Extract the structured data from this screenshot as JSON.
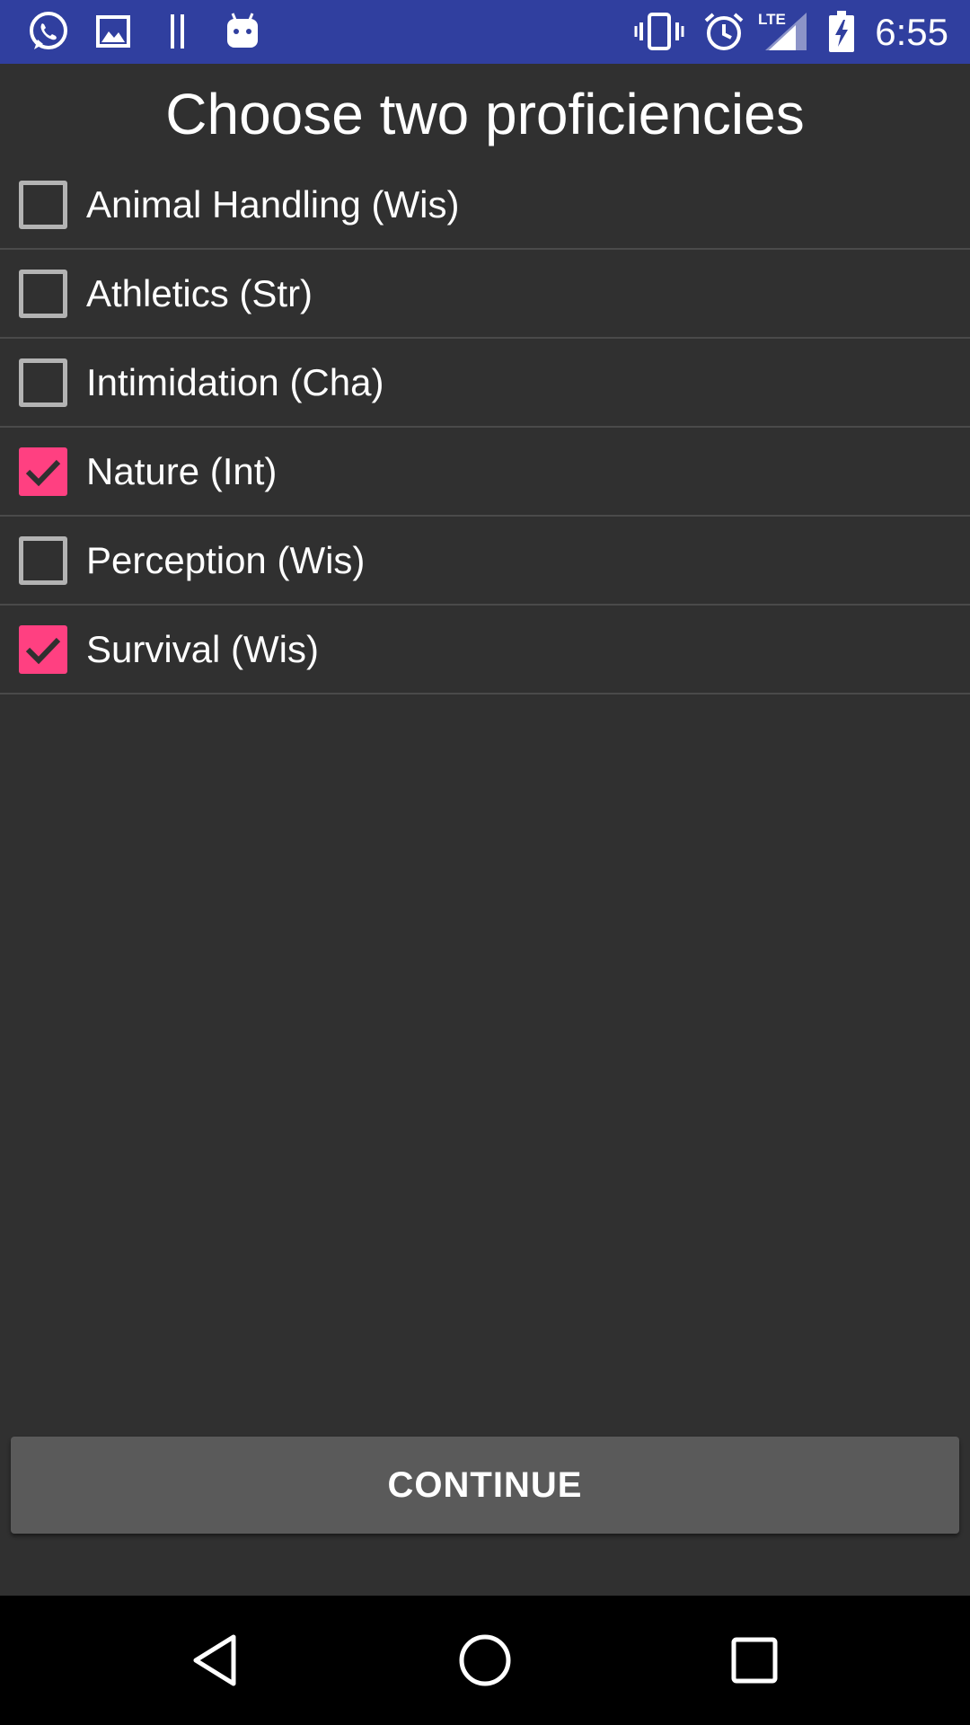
{
  "status_bar": {
    "time": "6:55",
    "network_label": "LTE",
    "left_icons": [
      "whatsapp-icon",
      "image-icon",
      "pause-bars-icon",
      "android-icon"
    ],
    "right_icons": [
      "vibrate-icon",
      "alarm-icon",
      "lte-signal-icon",
      "battery-charging-icon"
    ]
  },
  "screen": {
    "title": "Choose two proficiencies"
  },
  "proficiencies": [
    {
      "label": "Animal Handling (Wis)",
      "checked": false
    },
    {
      "label": "Athletics (Str)",
      "checked": false
    },
    {
      "label": "Intimidation (Cha)",
      "checked": false
    },
    {
      "label": "Nature (Int)",
      "checked": true
    },
    {
      "label": "Perception (Wis)",
      "checked": false
    },
    {
      "label": "Survival (Wis)",
      "checked": true
    }
  ],
  "actions": {
    "continue_label": "CONTINUE"
  },
  "nav_bar": {
    "icons": [
      "back-icon",
      "home-icon",
      "recents-icon"
    ]
  },
  "colors": {
    "status_bar": "#303f9f",
    "background": "#303030",
    "accent": "#ff4081",
    "button": "#5a5a5a",
    "nav_bar": "#000000"
  }
}
